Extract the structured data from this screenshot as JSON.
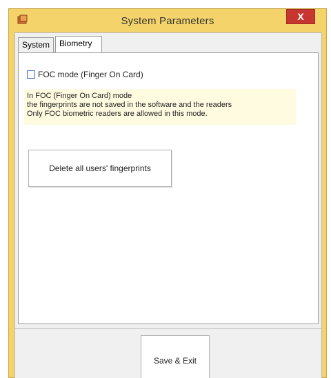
{
  "window": {
    "title": "System Parameters",
    "close_label": "X"
  },
  "tabs": [
    {
      "label": "System"
    },
    {
      "label": "Biometry"
    }
  ],
  "biometry": {
    "foc_checkbox_label": "FOC mode (Finger On Card)",
    "foc_checked": false,
    "info_lines": [
      "In FOC (Finger On Card) mode",
      "the fingerprints are not saved in the software and the readers",
      "Only FOC biometric readers are allowed in this mode."
    ],
    "delete_button_label": "Delete all users' fingerprints"
  },
  "footer": {
    "save_label": "Save & Exit"
  }
}
